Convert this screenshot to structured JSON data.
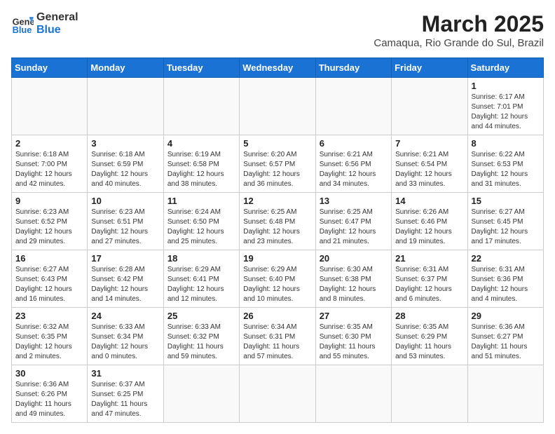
{
  "header": {
    "logo_general": "General",
    "logo_blue": "Blue",
    "title": "March 2025",
    "subtitle": "Camaqua, Rio Grande do Sul, Brazil"
  },
  "weekdays": [
    "Sunday",
    "Monday",
    "Tuesday",
    "Wednesday",
    "Thursday",
    "Friday",
    "Saturday"
  ],
  "weeks": [
    [
      {
        "day": "",
        "info": ""
      },
      {
        "day": "",
        "info": ""
      },
      {
        "day": "",
        "info": ""
      },
      {
        "day": "",
        "info": ""
      },
      {
        "day": "",
        "info": ""
      },
      {
        "day": "",
        "info": ""
      },
      {
        "day": "1",
        "info": "Sunrise: 6:17 AM\nSunset: 7:01 PM\nDaylight: 12 hours\nand 44 minutes."
      }
    ],
    [
      {
        "day": "2",
        "info": "Sunrise: 6:18 AM\nSunset: 7:00 PM\nDaylight: 12 hours\nand 42 minutes."
      },
      {
        "day": "3",
        "info": "Sunrise: 6:18 AM\nSunset: 6:59 PM\nDaylight: 12 hours\nand 40 minutes."
      },
      {
        "day": "4",
        "info": "Sunrise: 6:19 AM\nSunset: 6:58 PM\nDaylight: 12 hours\nand 38 minutes."
      },
      {
        "day": "5",
        "info": "Sunrise: 6:20 AM\nSunset: 6:57 PM\nDaylight: 12 hours\nand 36 minutes."
      },
      {
        "day": "6",
        "info": "Sunrise: 6:21 AM\nSunset: 6:56 PM\nDaylight: 12 hours\nand 34 minutes."
      },
      {
        "day": "7",
        "info": "Sunrise: 6:21 AM\nSunset: 6:54 PM\nDaylight: 12 hours\nand 33 minutes."
      },
      {
        "day": "8",
        "info": "Sunrise: 6:22 AM\nSunset: 6:53 PM\nDaylight: 12 hours\nand 31 minutes."
      }
    ],
    [
      {
        "day": "9",
        "info": "Sunrise: 6:23 AM\nSunset: 6:52 PM\nDaylight: 12 hours\nand 29 minutes."
      },
      {
        "day": "10",
        "info": "Sunrise: 6:23 AM\nSunset: 6:51 PM\nDaylight: 12 hours\nand 27 minutes."
      },
      {
        "day": "11",
        "info": "Sunrise: 6:24 AM\nSunset: 6:50 PM\nDaylight: 12 hours\nand 25 minutes."
      },
      {
        "day": "12",
        "info": "Sunrise: 6:25 AM\nSunset: 6:48 PM\nDaylight: 12 hours\nand 23 minutes."
      },
      {
        "day": "13",
        "info": "Sunrise: 6:25 AM\nSunset: 6:47 PM\nDaylight: 12 hours\nand 21 minutes."
      },
      {
        "day": "14",
        "info": "Sunrise: 6:26 AM\nSunset: 6:46 PM\nDaylight: 12 hours\nand 19 minutes."
      },
      {
        "day": "15",
        "info": "Sunrise: 6:27 AM\nSunset: 6:45 PM\nDaylight: 12 hours\nand 17 minutes."
      }
    ],
    [
      {
        "day": "16",
        "info": "Sunrise: 6:27 AM\nSunset: 6:43 PM\nDaylight: 12 hours\nand 16 minutes."
      },
      {
        "day": "17",
        "info": "Sunrise: 6:28 AM\nSunset: 6:42 PM\nDaylight: 12 hours\nand 14 minutes."
      },
      {
        "day": "18",
        "info": "Sunrise: 6:29 AM\nSunset: 6:41 PM\nDaylight: 12 hours\nand 12 minutes."
      },
      {
        "day": "19",
        "info": "Sunrise: 6:29 AM\nSunset: 6:40 PM\nDaylight: 12 hours\nand 10 minutes."
      },
      {
        "day": "20",
        "info": "Sunrise: 6:30 AM\nSunset: 6:38 PM\nDaylight: 12 hours\nand 8 minutes."
      },
      {
        "day": "21",
        "info": "Sunrise: 6:31 AM\nSunset: 6:37 PM\nDaylight: 12 hours\nand 6 minutes."
      },
      {
        "day": "22",
        "info": "Sunrise: 6:31 AM\nSunset: 6:36 PM\nDaylight: 12 hours\nand 4 minutes."
      }
    ],
    [
      {
        "day": "23",
        "info": "Sunrise: 6:32 AM\nSunset: 6:35 PM\nDaylight: 12 hours\nand 2 minutes."
      },
      {
        "day": "24",
        "info": "Sunrise: 6:33 AM\nSunset: 6:34 PM\nDaylight: 12 hours\nand 0 minutes."
      },
      {
        "day": "25",
        "info": "Sunrise: 6:33 AM\nSunset: 6:32 PM\nDaylight: 11 hours\nand 59 minutes."
      },
      {
        "day": "26",
        "info": "Sunrise: 6:34 AM\nSunset: 6:31 PM\nDaylight: 11 hours\nand 57 minutes."
      },
      {
        "day": "27",
        "info": "Sunrise: 6:35 AM\nSunset: 6:30 PM\nDaylight: 11 hours\nand 55 minutes."
      },
      {
        "day": "28",
        "info": "Sunrise: 6:35 AM\nSunset: 6:29 PM\nDaylight: 11 hours\nand 53 minutes."
      },
      {
        "day": "29",
        "info": "Sunrise: 6:36 AM\nSunset: 6:27 PM\nDaylight: 11 hours\nand 51 minutes."
      }
    ],
    [
      {
        "day": "30",
        "info": "Sunrise: 6:36 AM\nSunset: 6:26 PM\nDaylight: 11 hours\nand 49 minutes."
      },
      {
        "day": "31",
        "info": "Sunrise: 6:37 AM\nSunset: 6:25 PM\nDaylight: 11 hours\nand 47 minutes."
      },
      {
        "day": "",
        "info": ""
      },
      {
        "day": "",
        "info": ""
      },
      {
        "day": "",
        "info": ""
      },
      {
        "day": "",
        "info": ""
      },
      {
        "day": "",
        "info": ""
      }
    ]
  ]
}
